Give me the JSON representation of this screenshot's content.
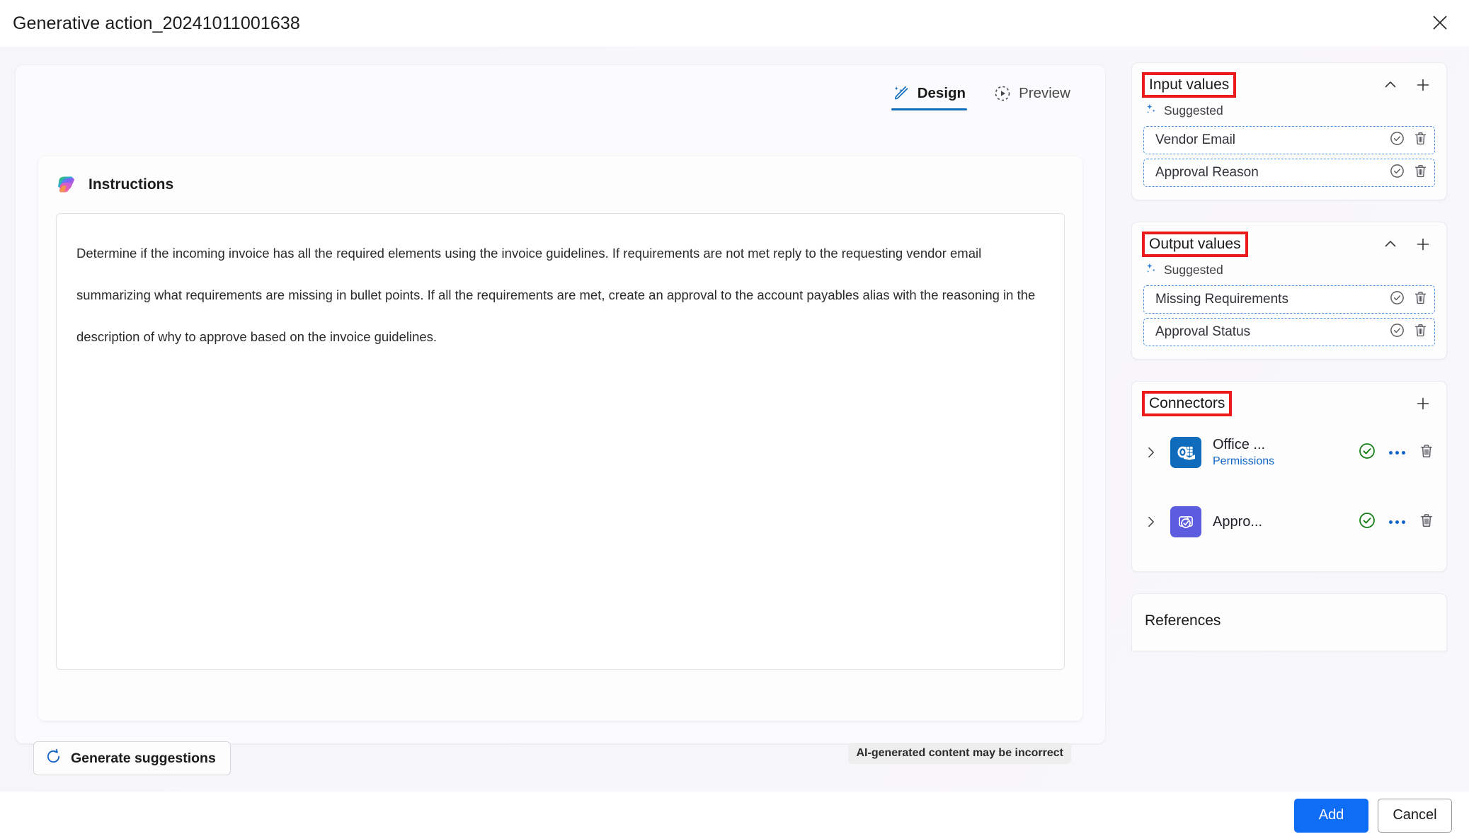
{
  "dialog": {
    "title": "Generative action_20241011001638",
    "close_icon": "close-icon"
  },
  "tabs": [
    {
      "label": "Design",
      "icon": "wand-sparkle-icon",
      "active": true
    },
    {
      "label": "Preview",
      "icon": "play-circle-dashed-icon",
      "active": false
    }
  ],
  "instructions": {
    "heading": "Instructions",
    "icon": "copilot-icon",
    "text": "Determine if the incoming invoice has all the required elements using the invoice guidelines. If requirements are not met reply to the requesting vendor email summarizing what requirements are missing in bullet points. If all the requirements are met, create an approval to the account payables alias with the reasoning in the description of why to approve based on the invoice guidelines.",
    "generate_button": "Generate suggestions",
    "generate_icon": "arrow-clockwise-icon",
    "ai_note": "AI-generated content may be incorrect"
  },
  "input_values": {
    "title": "Input values",
    "highlighted": true,
    "collapse_icon": "chevron-up-icon",
    "add_icon": "plus-icon",
    "suggested_label": "Suggested",
    "suggested_icon": "sparkle-icon",
    "items": [
      {
        "name": "Vendor Email",
        "accept_icon": "checkmark-circle-icon",
        "delete_icon": "trash-icon"
      },
      {
        "name": "Approval Reason",
        "accept_icon": "checkmark-circle-icon",
        "delete_icon": "trash-icon"
      }
    ]
  },
  "output_values": {
    "title": "Output values",
    "highlighted": true,
    "collapse_icon": "chevron-up-icon",
    "add_icon": "plus-icon",
    "suggested_label": "Suggested",
    "suggested_icon": "sparkle-icon",
    "items": [
      {
        "name": "Missing Requirements",
        "accept_icon": "checkmark-circle-icon",
        "delete_icon": "trash-icon"
      },
      {
        "name": "Approval Status",
        "accept_icon": "checkmark-circle-icon",
        "delete_icon": "trash-icon"
      }
    ]
  },
  "connectors": {
    "title": "Connectors",
    "highlighted": true,
    "add_icon": "plus-icon",
    "items": [
      {
        "name": "Office ...",
        "sub": "Permissions",
        "logo": "outlook-icon",
        "logo_color": "#0f6cbd",
        "status_icon": "checkmark-circle-green-icon",
        "more_icon": "more-horizontal-icon",
        "delete_icon": "trash-icon",
        "expand_icon": "chevron-right-icon"
      },
      {
        "name": "Appro...",
        "sub": "",
        "logo": "approvals-icon",
        "logo_color": "#5c5ce0",
        "status_icon": "checkmark-circle-green-icon",
        "more_icon": "more-horizontal-icon",
        "delete_icon": "trash-icon",
        "expand_icon": "chevron-right-icon"
      }
    ]
  },
  "references": {
    "title": "References"
  },
  "footer": {
    "primary": "Add",
    "secondary": "Cancel"
  },
  "colors": {
    "accent": "#0f6cf5",
    "tab_accent": "#0f6cbd",
    "link": "#1064c8",
    "highlight_box": "#ec1b1b",
    "status_green": "#107c10",
    "dashed_border": "#4a90e2"
  }
}
